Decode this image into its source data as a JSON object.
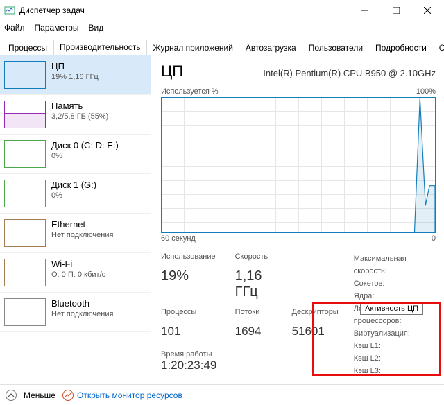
{
  "window": {
    "title": "Диспетчер задач"
  },
  "menu": {
    "file": "Файл",
    "options": "Параметры",
    "view": "Вид"
  },
  "tabs": {
    "processes": "Процессы",
    "performance": "Производительность",
    "app_history": "Журнал приложений",
    "startup": "Автозагрузка",
    "users": "Пользователи",
    "details": "Подробности",
    "services": "С."
  },
  "sidebar": {
    "cpu": {
      "title": "ЦП",
      "sub": "19%  1,16 ГГц"
    },
    "memory": {
      "title": "Память",
      "sub": "3,2/5,8 ГБ (55%)"
    },
    "disk0": {
      "title": "Диск 0 (C: D: E:)",
      "sub": "0%"
    },
    "disk1": {
      "title": "Диск 1 (G:)",
      "sub": "0%"
    },
    "ethernet": {
      "title": "Ethernet",
      "sub": "Нет подключения"
    },
    "wifi": {
      "title": "Wi-Fi",
      "sub": "О: 0  П: 0 кбит/с"
    },
    "bluetooth": {
      "title": "Bluetooth",
      "sub": "Нет подключения"
    }
  },
  "main": {
    "title": "ЦП",
    "cpu_model": "Intel(R) Pentium(R) CPU B950 @ 2.10GHz",
    "chart_top_left": "Используется %",
    "chart_top_right": "100%",
    "chart_bottom_left": "60 секунд",
    "chart_bottom_right": "0",
    "tooltip": "Активность ЦП",
    "stats": {
      "usage_label": "Использование",
      "usage_value": "19%",
      "speed_label": "Скорость",
      "speed_value": "1,16 ГГц",
      "proc_label": "Процессы",
      "proc_value": "101",
      "threads_label": "Потоки",
      "threads_value": "1694",
      "handles_label": "Дескрипторы",
      "handles_value": "51601",
      "uptime_label": "Время работы",
      "uptime_value": "1:20:23:49"
    },
    "info": {
      "max_speed": "Максимальная скорость:",
      "sockets": "Сокетов:",
      "cores": "Ядра:",
      "logical": "Логических процессоров:",
      "virt": "Виртуализация:",
      "l1": "Кэш L1:",
      "l2": "Кэш L2:",
      "l3": "Кэш L3:"
    }
  },
  "footer": {
    "fewer": "Меньше",
    "resmon": "Открыть монитор ресурсов"
  },
  "chart_data": {
    "type": "line",
    "title": "Активность ЦП",
    "xlabel": "60 секунд",
    "ylabel": "Используется %",
    "xlim": [
      60,
      0
    ],
    "ylim": [
      0,
      100
    ],
    "x": [
      60,
      57,
      54,
      51,
      48,
      45,
      42,
      39,
      36,
      33,
      30,
      27,
      24,
      21,
      18,
      15,
      12,
      9,
      6,
      3,
      1,
      0
    ],
    "values": [
      0,
      0,
      0,
      0,
      0,
      0,
      0,
      0,
      0,
      0,
      0,
      0,
      0,
      0,
      0,
      0,
      0,
      0,
      0,
      100,
      20,
      32
    ]
  }
}
